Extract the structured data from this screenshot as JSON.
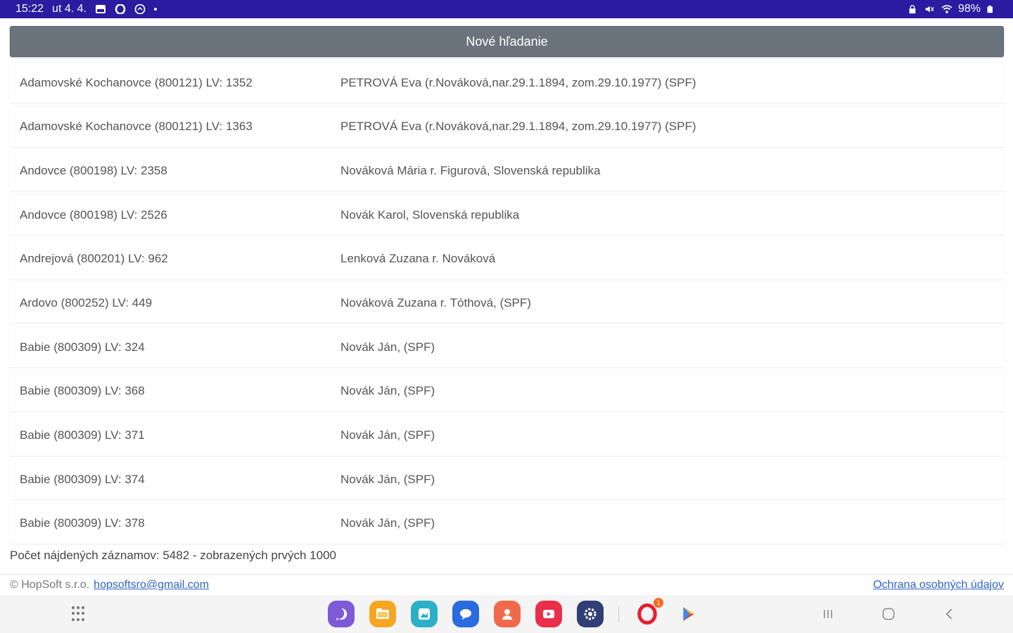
{
  "status": {
    "time": "15:22",
    "date": "ut 4. 4.",
    "battery": "98%"
  },
  "header": {
    "new_search_label": "Nové hľadanie"
  },
  "results": [
    {
      "location": "Adamovské Kochanovce (800121) LV: 1352",
      "owner": "PETROVÁ Eva (r.Nováková,nar.29.1.1894, zom.29.10.1977) (SPF)"
    },
    {
      "location": "Adamovské Kochanovce (800121) LV: 1363",
      "owner": "PETROVÁ Eva (r.Nováková,nar.29.1.1894, zom.29.10.1977) (SPF)"
    },
    {
      "location": "Andovce (800198) LV: 2358",
      "owner": "Nováková Mária r. Figurová, Slovenská republika"
    },
    {
      "location": "Andovce (800198) LV: 2526",
      "owner": "Novák Karol, Slovenská republika"
    },
    {
      "location": "Andrejová (800201) LV: 962",
      "owner": "Lenková Zuzana r. Nováková"
    },
    {
      "location": "Ardovo (800252) LV: 449",
      "owner": "Nováková Zuzana r. Tóthová, (SPF)"
    },
    {
      "location": "Babie (800309) LV: 324",
      "owner": "Novák Ján, (SPF)"
    },
    {
      "location": "Babie (800309) LV: 368",
      "owner": "Novák Ján, (SPF)"
    },
    {
      "location": "Babie (800309) LV: 371",
      "owner": "Novák Ján, (SPF)"
    },
    {
      "location": "Babie (800309) LV: 374",
      "owner": "Novák Ján, (SPF)"
    },
    {
      "location": "Babie (800309) LV: 378",
      "owner": "Novák Ján, (SPF)"
    }
  ],
  "summary": {
    "count_text": "Počet nájdených záznamov: 5482 - zobrazených prvých 1000"
  },
  "footer": {
    "copyright": "© HopSoft s.r.o.",
    "email": "hopsoftsro@gmail.com",
    "privacy": "Ochrana osobných údajov"
  },
  "dock": {
    "apps": [
      {
        "icon": "viber-icon",
        "color": "#7d5ad6"
      },
      {
        "icon": "folder-icon",
        "color": "#f6a623"
      },
      {
        "icon": "gallery-icon",
        "color": "#2bb0c8"
      },
      {
        "icon": "messages-icon",
        "color": "#2a6be0"
      },
      {
        "icon": "contacts-icon",
        "color": "#ef6a4c"
      },
      {
        "icon": "youtube-icon",
        "color": "#e8304a"
      },
      {
        "icon": "settings-icon",
        "color": "#2f3e74"
      },
      {
        "icon": "opera-icon",
        "color": "#e81e2c"
      },
      {
        "icon": "play-store-icon",
        "color": "#34a853"
      }
    ],
    "badge": "1"
  }
}
